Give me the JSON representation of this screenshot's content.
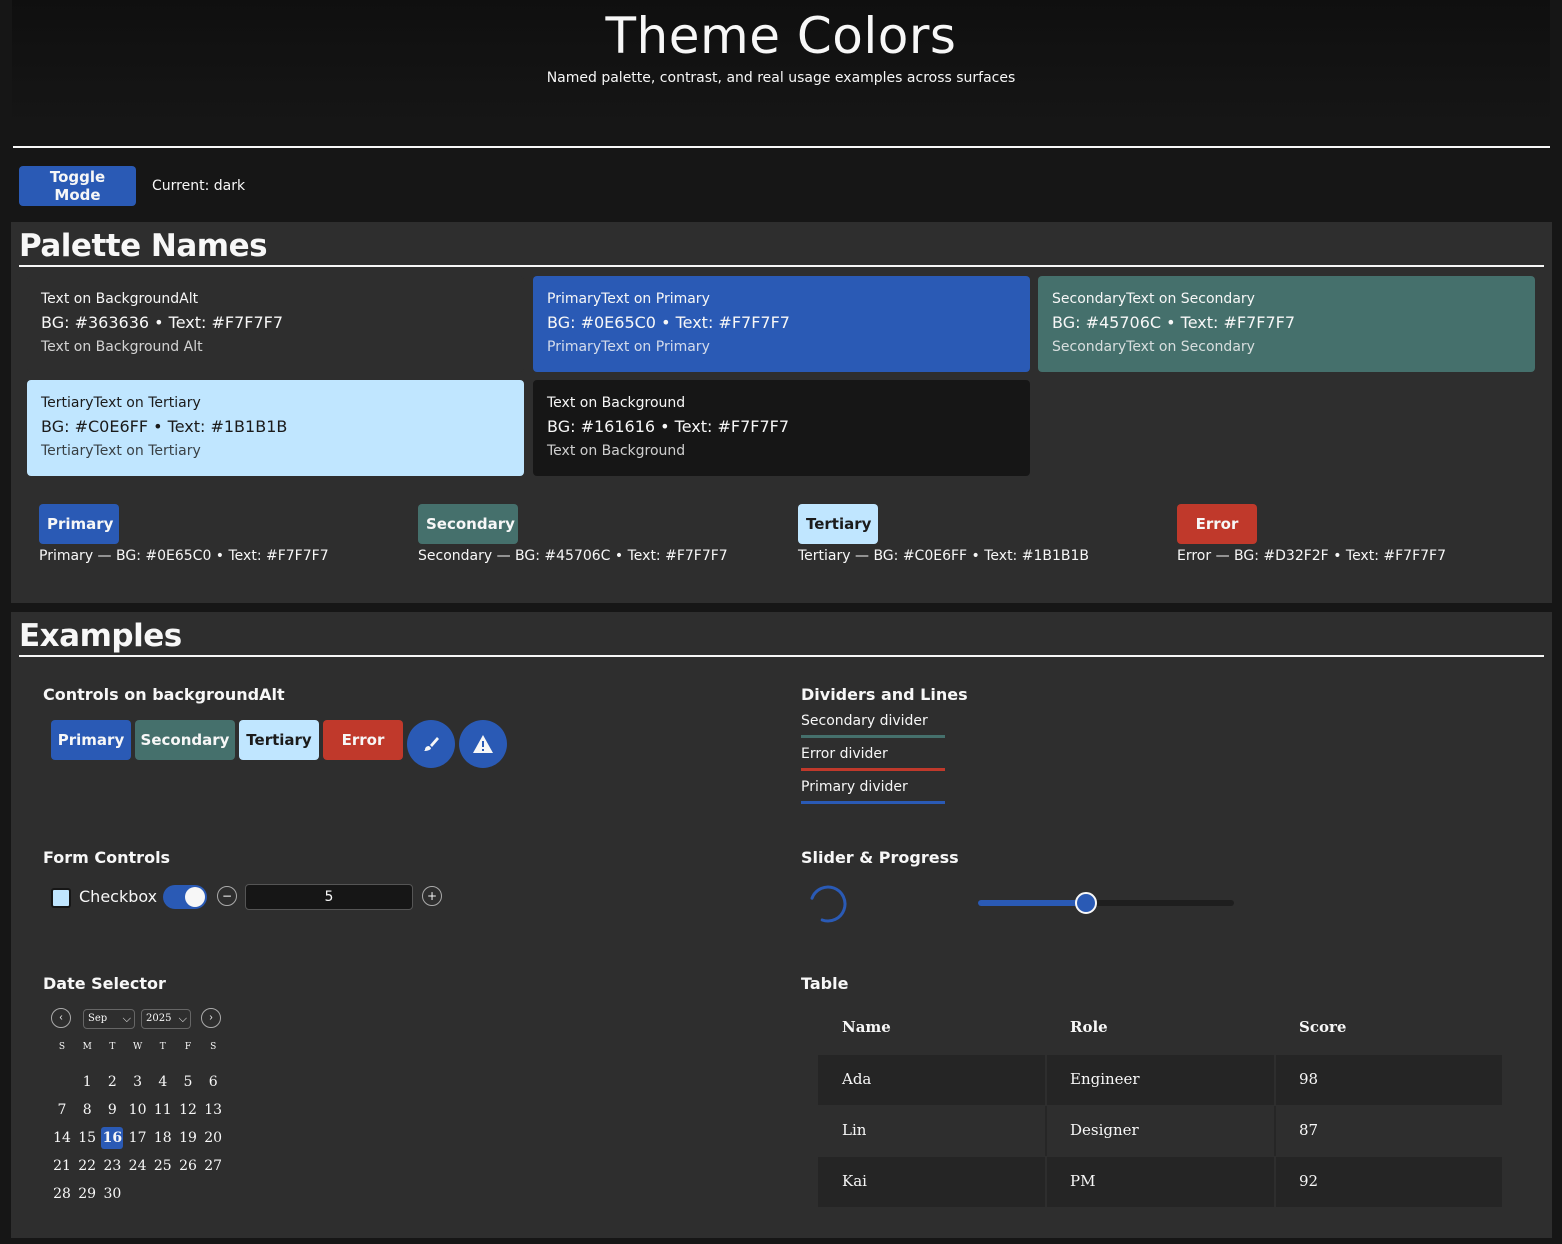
{
  "header": {
    "title": "Theme Colors",
    "subtitle": "Named palette, contrast, and real usage examples across surfaces"
  },
  "toolbar": {
    "toggle_label": "Toggle Mode",
    "current_text": "Current: dark"
  },
  "palette": {
    "title": "Palette Names",
    "cards": [
      {
        "title": "Text on BackgroundAlt",
        "values": "BG: #363636 • Text: #F7F7F7",
        "sample": "Text on Background Alt",
        "bg": "#2e2e2e",
        "fg": "#F7F7F7"
      },
      {
        "title": "PrimaryText on Primary",
        "values": "BG: #0E65C0 • Text: #F7F7F7",
        "sample": "PrimaryText on Primary",
        "bg": "#2a5ab5",
        "fg": "#F7F7F7"
      },
      {
        "title": "SecondaryText on Secondary",
        "values": "BG: #45706C • Text: #F7F7F7",
        "sample": "SecondaryText on Secondary",
        "bg": "#45706C",
        "fg": "#F7F7F7"
      },
      {
        "title": "TertiaryText on Tertiary",
        "values": "BG: #C0E6FF • Text: #1B1B1B",
        "sample": "TertiaryText on Tertiary",
        "bg": "#C0E6FF",
        "fg": "#1B1B1B"
      },
      {
        "title": "Text on Background",
        "values": "BG: #161616 • Text: #F7F7F7",
        "sample": "Text on Background",
        "bg": "#161616",
        "fg": "#F7F7F7"
      }
    ],
    "swatches": [
      {
        "label": "Primary",
        "caption": "Primary — BG: #0E65C0 • Text: #F7F7F7",
        "bg": "#2a5ab5",
        "fg": "#F7F7F7"
      },
      {
        "label": "Secondary",
        "caption": "Secondary — BG: #45706C • Text: #F7F7F7",
        "bg": "#45706C",
        "fg": "#F7F7F7"
      },
      {
        "label": "Tertiary",
        "caption": "Tertiary — BG: #C0E6FF • Text: #1B1B1B",
        "bg": "#C0E6FF",
        "fg": "#1B1B1B"
      },
      {
        "label": "Error",
        "caption": "Error — BG: #D32F2F • Text: #F7F7F7",
        "bg": "#c0392b",
        "fg": "#F7F7F7"
      }
    ]
  },
  "examples": {
    "title": "Examples",
    "controls": {
      "heading": "Controls on backgroundAlt",
      "primary": "Primary",
      "secondary": "Secondary",
      "tertiary": "Tertiary",
      "error": "Error",
      "icons": [
        "brush-icon",
        "warning-icon"
      ]
    },
    "dividers": {
      "heading": "Dividers and Lines",
      "secondary": "Secondary divider",
      "error": "Error divider",
      "primary": "Primary divider"
    },
    "form": {
      "heading": "Form Controls",
      "checkbox_label": "Checkbox",
      "checkbox_checked": false,
      "switch_on": true,
      "stepper_value": "5",
      "minus": "−",
      "plus": "+"
    },
    "slider": {
      "heading": "Slider & Progress",
      "value_fraction": 0.42
    },
    "date": {
      "heading": "Date Selector",
      "month": "Sep",
      "year": "2025",
      "prev": "‹",
      "next": "›",
      "weekdays": [
        "S",
        "M",
        "T",
        "W",
        "T",
        "F",
        "S"
      ],
      "first_weekday_index": 1,
      "days_in_month": 30,
      "selected_day": 16
    },
    "table": {
      "heading": "Table",
      "columns": [
        "Name",
        "Role",
        "Score"
      ],
      "rows": [
        [
          "Ada",
          "Engineer",
          "98"
        ],
        [
          "Lin",
          "Designer",
          "87"
        ],
        [
          "Kai",
          "PM",
          "92"
        ]
      ]
    }
  },
  "colors": {
    "primary": "#2a5ab5",
    "secondary": "#45706C",
    "tertiary": "#C0E6FF",
    "error": "#c0392b",
    "background": "#161616",
    "background_alt": "#2e2e2e",
    "text": "#F7F7F7"
  }
}
